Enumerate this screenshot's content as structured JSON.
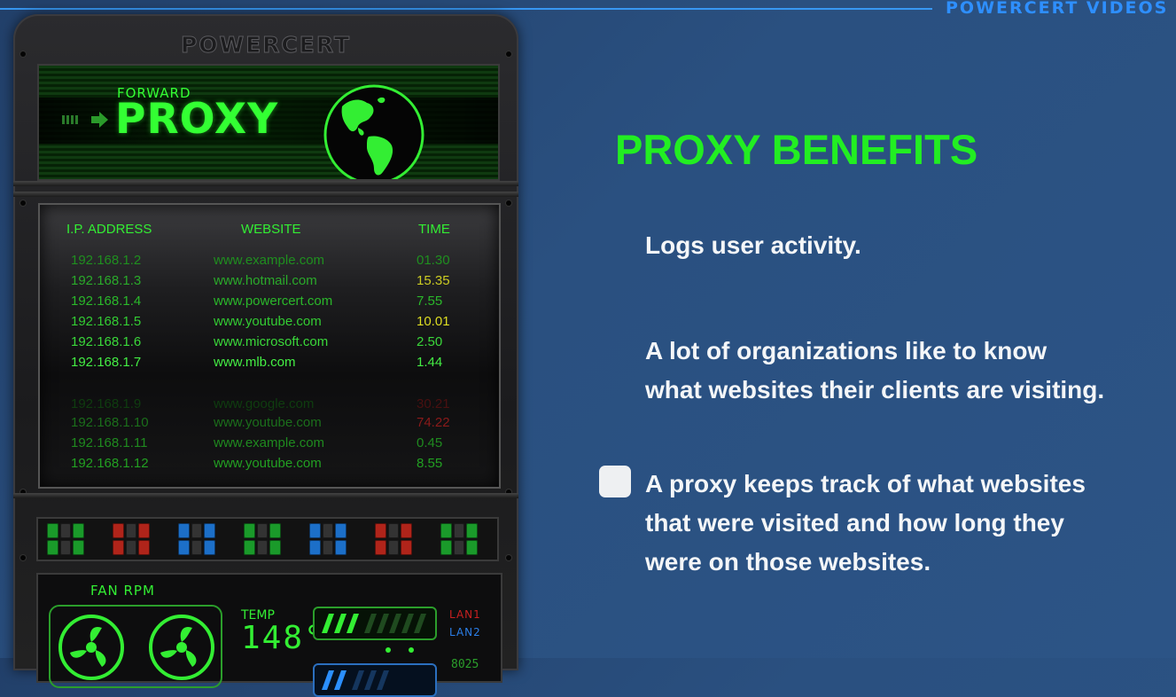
{
  "brand": "POWERCERT VIDEOS",
  "rack": {
    "brand": "POWERCERT",
    "banner": {
      "forward": "FORWARD",
      "proxy": "PROXY"
    },
    "log": {
      "headers": [
        "I.P. ADDRESS",
        "WEBSITE",
        "TIME"
      ],
      "rows": [
        {
          "ip": "192.168.1.2",
          "site": "www.example.com",
          "time": "01.30",
          "color": "#1f8f1f",
          "time_color": "#1f8f1f"
        },
        {
          "ip": "192.168.1.3",
          "site": "www.hotmail.com",
          "time": "15.35",
          "color": "#2aaa2a",
          "time_color": "#cccc22"
        },
        {
          "ip": "192.168.1.4",
          "site": "www.powercert.com",
          "time": "7.55",
          "color": "#2ab82a",
          "time_color": "#2ab82a"
        },
        {
          "ip": "192.168.1.5",
          "site": "www.youtube.com",
          "time": "10.01",
          "color": "#33cc33",
          "time_color": "#dddd22"
        },
        {
          "ip": "192.168.1.6",
          "site": "www.microsoft.com",
          "time": "2.50",
          "color": "#3ad83a",
          "time_color": "#3ad83a"
        },
        {
          "ip": "192.168.1.7",
          "site": "www.mlb.com",
          "time": "1.44",
          "color": "#44ee44",
          "time_color": "#44ee44"
        },
        {
          "ip": "192.168.1.9",
          "site": "www.google.com",
          "time": "30.21",
          "color": "#0f3d0f",
          "time_color": "#4a1010"
        },
        {
          "ip": "192.168.1.10",
          "site": "www.youtube.com",
          "time": "74.22",
          "color": "#1b6e1b",
          "time_color": "#8a1a1a"
        },
        {
          "ip": "192.168.1.11",
          "site": "www.example.com",
          "time": "0.45",
          "color": "#1f8a1f",
          "time_color": "#1f8a1f"
        },
        {
          "ip": "192.168.1.12",
          "site": "www.youtube.com",
          "time": "8.55",
          "color": "#22a022",
          "time_color": "#22a022"
        }
      ]
    },
    "switch_colors": [
      "#1a9a2a",
      "#b0241a",
      "#1c6fc8",
      "#1a9a2a",
      "#1c6fc8",
      "#b0241a",
      "#1a9a2a"
    ],
    "status": {
      "fan_label": "FAN RPM",
      "temp_label": "TEMP",
      "temp_value": "148°",
      "lan1": "LAN1",
      "lan2": "LAN2",
      "mini": "8025"
    }
  },
  "content": {
    "heading": "PROXY BENEFITS",
    "p1": "Logs user activity.",
    "p2_line1": "A lot of organizations like to know",
    "p2_line2": "what websites their clients are visiting.",
    "p3_line1": "A proxy keeps track of what websites",
    "p3_line2": "that were visited and how long they",
    "p3_line3": "were on those websites."
  },
  "colors": {
    "accent_green": "#22ee22",
    "text_white": "#f4f6f8",
    "brand_blue": "#2e8fff"
  }
}
